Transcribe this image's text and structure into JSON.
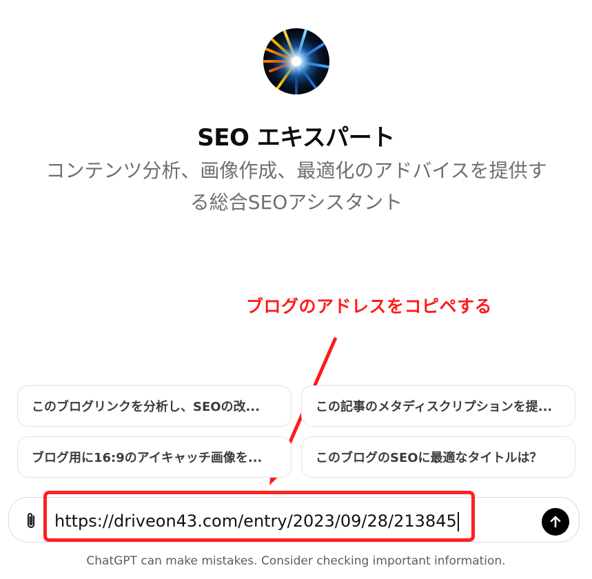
{
  "gpt": {
    "name": "SEO エキスパート",
    "description_line1": "コンテンツ分析、画像作成、最適化のアドバイスを提供す",
    "description_line2": "る総合SEOアシスタント"
  },
  "annotation": {
    "text": "ブログのアドレスをコピペする",
    "color": "#ff1a1a"
  },
  "suggestions": [
    {
      "label": "このブログリンクを分析し、SEOの改..."
    },
    {
      "label": "この記事のメタディスクリプションを提..."
    },
    {
      "label": "ブログ用に16:9のアイキャッチ画像を..."
    },
    {
      "label": "このブログのSEOに最適なタイトルは？"
    }
  ],
  "composer": {
    "value": "https://driveon43.com/entry/2023/09/28/213845",
    "attach_icon": "paperclip-icon",
    "send_icon": "arrow-up-icon"
  },
  "footer": {
    "disclaimer": "ChatGPT can make mistakes. Consider checking important information."
  }
}
